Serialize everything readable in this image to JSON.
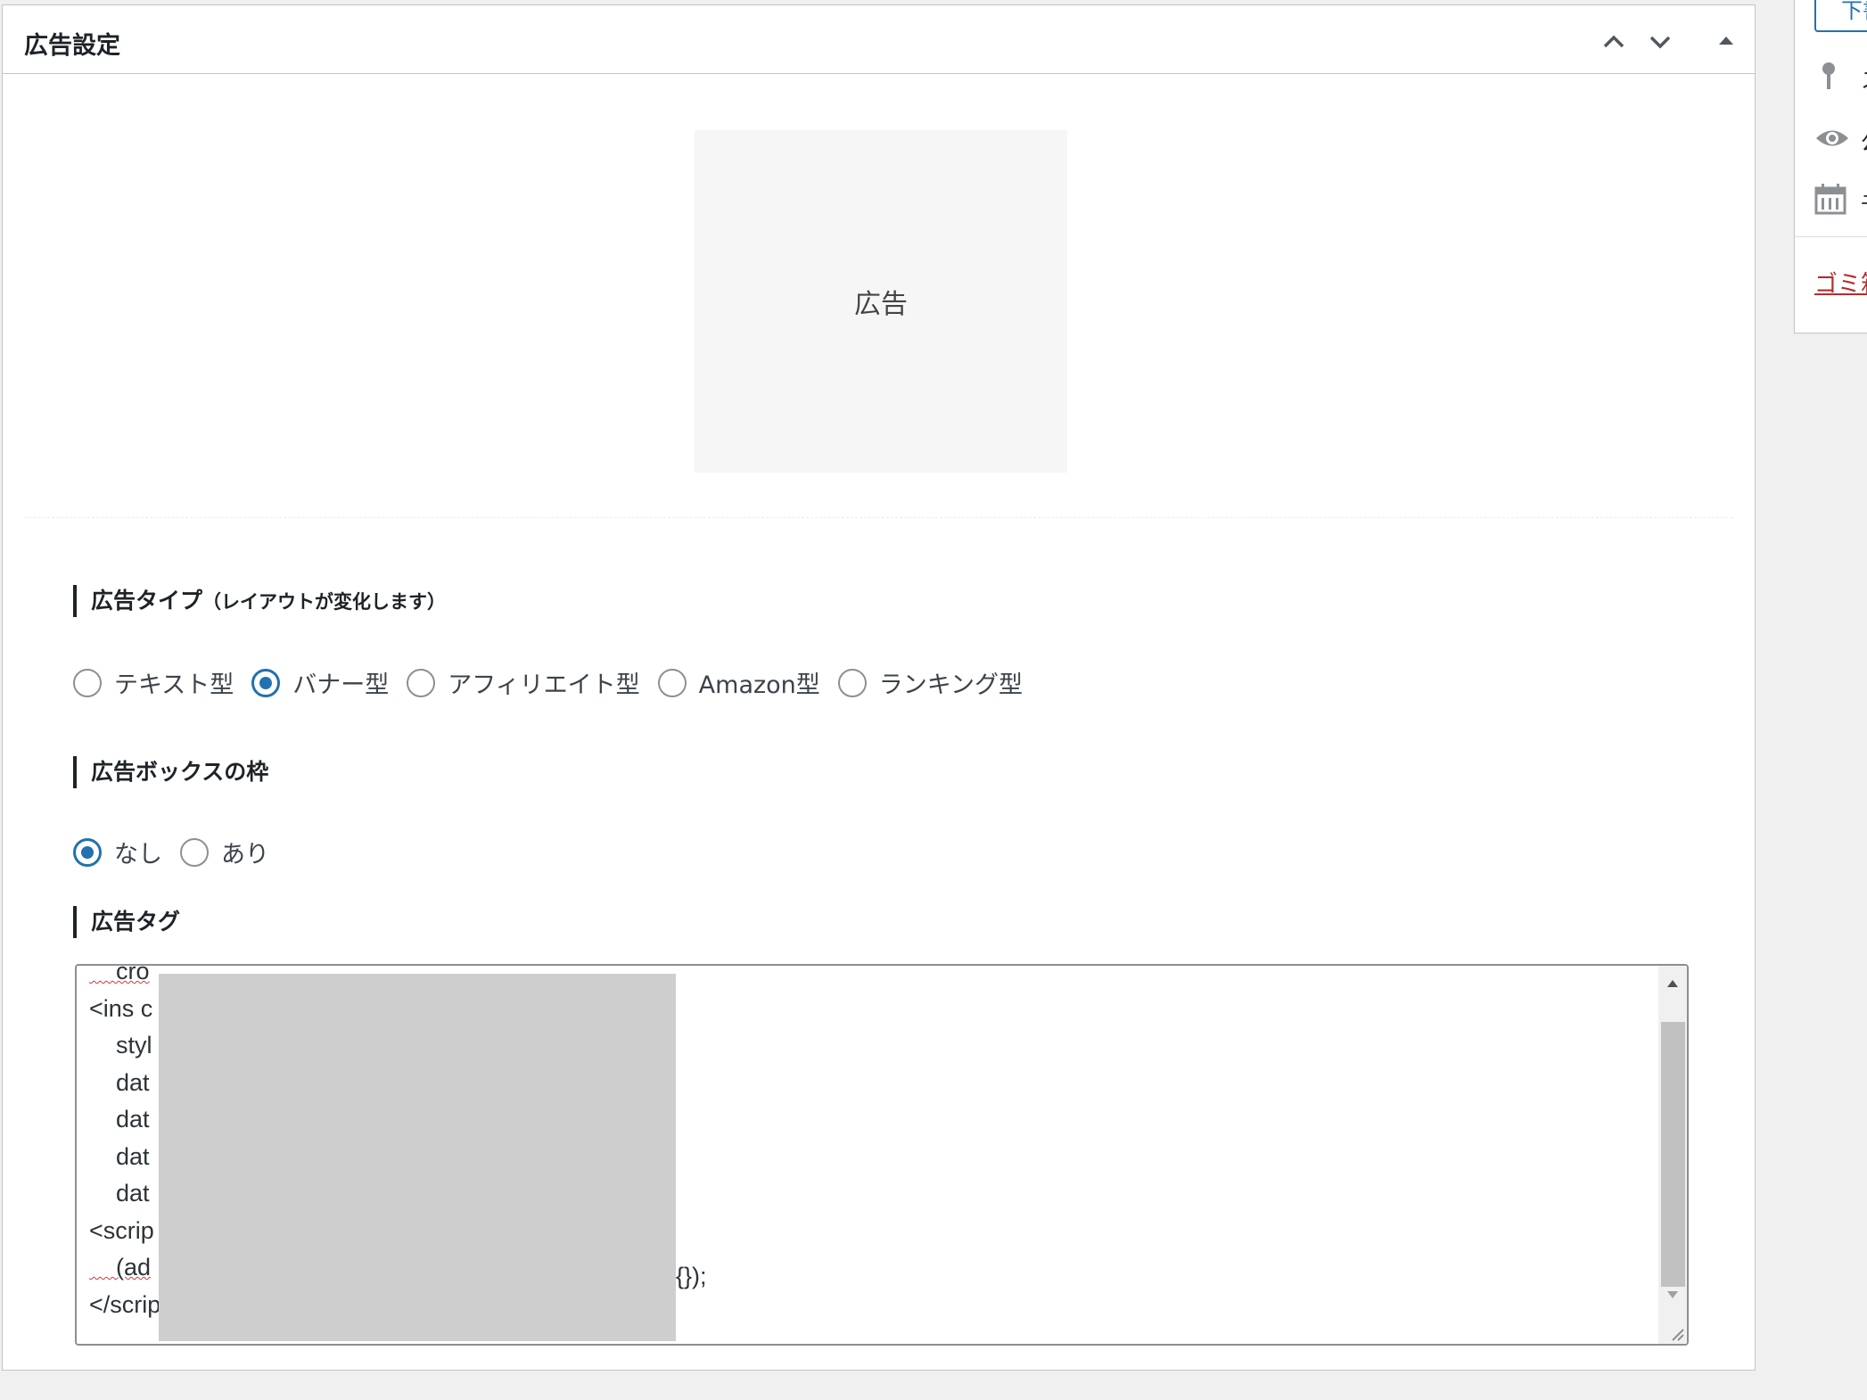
{
  "metabox": {
    "title": "広告設定",
    "preview_label": "広告"
  },
  "ad_type": {
    "label": "広告タイプ",
    "note": "（レイアウトが変化します）",
    "options": [
      {
        "label": "テキスト型",
        "checked": false
      },
      {
        "label": "バナー型",
        "checked": true
      },
      {
        "label": "アフィリエイト型",
        "checked": false
      },
      {
        "label": "Amazon型",
        "checked": false
      },
      {
        "label": "ランキング型",
        "checked": false
      }
    ]
  },
  "ad_border": {
    "label": "広告ボックスの枠",
    "options": [
      {
        "label": "なし",
        "checked": true
      },
      {
        "label": "あり",
        "checked": false
      }
    ]
  },
  "ad_tag": {
    "label": "広告タグ",
    "lines": [
      "    cro",
      "<ins c",
      "    styl",
      "    dat",
      "    dat",
      "    dat",
      "    dat",
      "<scrip",
      "    (ad",
      "</scrip"
    ],
    "line_tail": "{});"
  },
  "sidebar": {
    "button_text": "下書",
    "item_texts": [
      "ス",
      "公",
      "予"
    ],
    "trash_link": "ゴミ箱"
  },
  "colors": {
    "accent": "#2271b1",
    "trash": "#b32d2e",
    "redaction": "#cfcecf"
  }
}
